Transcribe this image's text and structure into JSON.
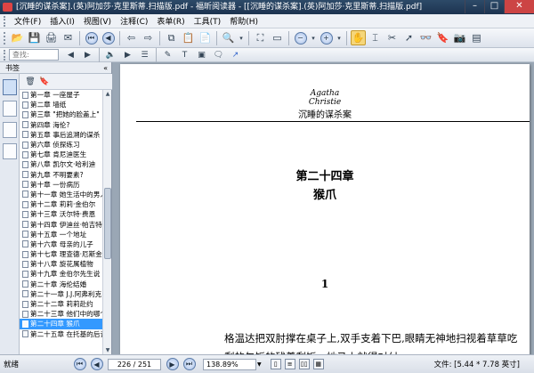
{
  "window": {
    "title": "[沉睡的谋杀案].(英)阿加莎·克里斯蒂.扫描版.pdf - 福昕阅读器 - [[沉睡的谋杀案].(英)阿加莎·克里斯蒂.扫描版.pdf]",
    "min": "–",
    "max": "□",
    "close": "✕"
  },
  "menu": [
    "文件(F)",
    "插入(I)",
    "视图(V)",
    "注释(C)",
    "表单(R)",
    "工具(T)",
    "帮助(H)"
  ],
  "toolbar": {
    "search_placeholder": "查找:"
  },
  "sidebar": {
    "header": "书签",
    "collapse": "«",
    "items": [
      "第一章  一座屋子",
      "第二章  墙纸",
      "第三章  \"把她的脸盖上\"",
      "第四章  海伦?",
      "第五章  事后追溯的谋杀",
      "第六章  侦探练习",
      "第七章  肯尼迪医生",
      "第八章  凯尔文·哈利迪",
      "第九章  不明要素?",
      "第十章  一份病历",
      "第十一章  她生活中的男人",
      "第十二章  莉莉·金伯尔",
      "第十三章  沃尔特·费恩",
      "第十四章  伊迪丝·帕吉特",
      "第十五章  一个地址",
      "第十六章  母亲的儿子",
      "第十七章  理查德·厄斯金",
      "第十八章  旋花属植物",
      "第十九章  金伯尔先生说",
      "第二十章  海伦结婚",
      "第二十一章  J.J.阿弗利克",
      "第二十二章  莉莉赴约",
      "第二十三章  他们中的哪个",
      "第二十四章  猴爪",
      "第二十五章  在托基的后记"
    ],
    "selected_index": 23
  },
  "page": {
    "logo": "Agatha Christie",
    "book_title": "沉睡的谋杀案",
    "chapter": "第二十四章",
    "chapter_name": "猴爪",
    "section": "1",
    "paragraph": "格温达把双肘撑在桌子上,双手支着下巴,眼睛无神地扫视着草草吃剩的午饭的残羹剩饭。她马上就得对付"
  },
  "status": {
    "ready": "就绪",
    "page": "226 / 251",
    "zoom": "138.89%",
    "file_size": "文件: [5.44 * 7.78 英寸]"
  }
}
